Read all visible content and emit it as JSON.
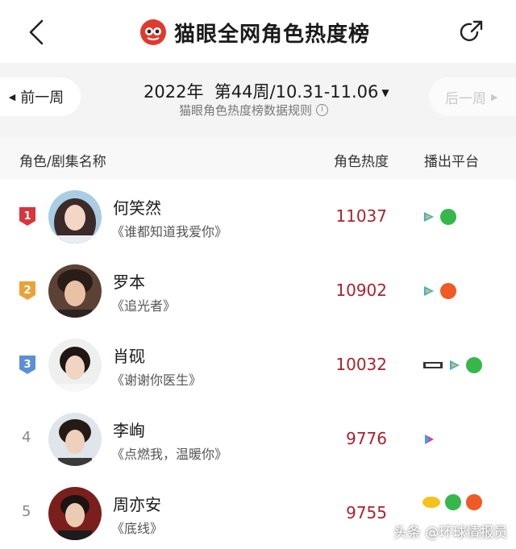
{
  "header": {
    "title": "猫眼全网角色热度榜",
    "back_icon": "chevron-left-icon",
    "share_icon": "share-icon",
    "logo_icon": "maoyan-cat-logo-icon"
  },
  "week": {
    "prev_label": "前一周",
    "next_label": "后一周",
    "period": "2022年  第44周/10.31-11.06",
    "rules": "猫眼角色热度榜数据规则"
  },
  "table": {
    "col_role": "角色/剧集名称",
    "col_heat": "角色热度",
    "col_platform": "播出平台"
  },
  "rows": [
    {
      "rank": "1",
      "name": "何笑然",
      "drama": "《谁都知道我爱你》",
      "heat": "11037",
      "platforms": [
        "tencent-video-icon",
        "iqiyi-icon"
      ]
    },
    {
      "rank": "2",
      "name": "罗本",
      "drama": "《追光者》",
      "heat": "10902",
      "platforms": [
        "tencent-video-icon",
        "mgtv-icon"
      ]
    },
    {
      "rank": "3",
      "name": "肖砚",
      "drama": "《谢谢你医生》",
      "heat": "10032",
      "platforms": [
        "cctv-icon",
        "tencent-video-icon",
        "iqiyi-icon"
      ]
    },
    {
      "rank": "4",
      "name": "李峋",
      "drama": "《点燃我，温暖你》",
      "heat": "9776",
      "platforms": [
        "youku-icon"
      ]
    },
    {
      "rank": "5",
      "name": "周亦安",
      "drama": "《底线》",
      "heat": "9755",
      "platforms": [
        "mango-tv-icon",
        "iqiyi-icon",
        "mgtv-icon"
      ]
    }
  ],
  "colors": {
    "heat": "#a8232e",
    "rank1": "#d7363c",
    "rank2": "#e9a23b",
    "rank3": "#5b8fd6",
    "brand": "#e03a2e"
  },
  "watermark": "头条 @环球情报员"
}
